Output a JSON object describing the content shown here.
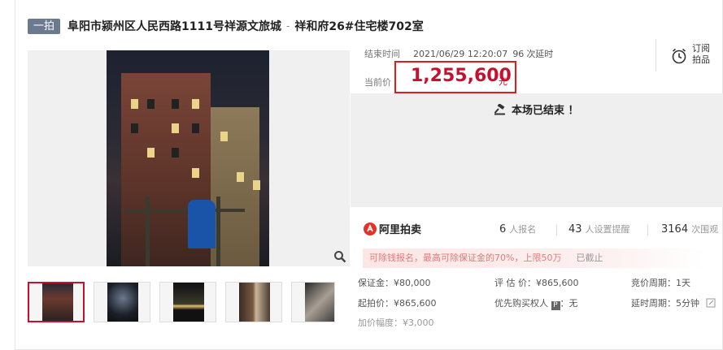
{
  "header": {
    "badge": "一拍",
    "title": "阜阳市颍州区人民西路1111号祥源文旅城",
    "separator": "-",
    "subtitle": "祥和府26#住宅楼702室"
  },
  "auction": {
    "end_label": "结束时间",
    "end_time": "2021/06/29 12:20:07",
    "extension_count": "96",
    "extension_label": "次延时",
    "current_price_label": "当前价",
    "current_price": "1,255,600",
    "currency_unit": "元",
    "subscribe_line1": "订阅",
    "subscribe_line2": "拍品",
    "ended_message": "本场已结束 ！"
  },
  "stats": {
    "brand": "阿里拍卖",
    "signups_count": "6",
    "signups_label": "人报名",
    "reminders_count": "43",
    "reminders_label": "人设置提醒",
    "views_count": "3164",
    "views_label": "次围观"
  },
  "notice": {
    "text": "可除钱报名，最高可除保证金的70%，上限50万",
    "status": "已截止"
  },
  "details": {
    "deposit": "保证金：¥80,000",
    "start_price": "起拍价：¥865,600",
    "increment": "加价幅度：¥3,000",
    "appraisal": "评 估 价：¥865,600",
    "priority_prefix": "优先购买权人",
    "priority_icon": "P",
    "priority_suffix": "：无",
    "cycle": "竞价周期：1天",
    "delay": "延时周期：5分钟"
  },
  "colors": {
    "price_red": "#c8102e",
    "highlight_border": "#e31b1b",
    "badge_bg": "#6b7a8f",
    "brand_red": "#e8302a"
  },
  "icons": [
    "auction-hammer-icon",
    "alarm-clock-icon",
    "zoom-icon",
    "edit-pencil-icon",
    "ali-auction-logo-icon"
  ]
}
